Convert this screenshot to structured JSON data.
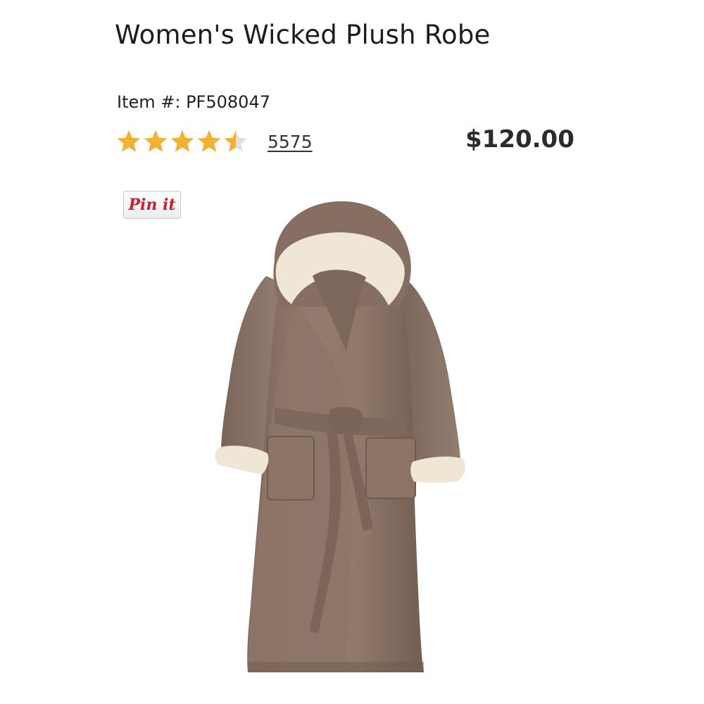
{
  "product": {
    "title": "Women's Wicked Plush Robe",
    "item_number": "Item #: PF508047",
    "rating": 4.5,
    "rating_max": 5,
    "review_count": "5575",
    "price": "$120.00"
  },
  "pin_button": {
    "label": "Pin it"
  },
  "colors": {
    "star": "#F2B134",
    "star_empty": "#E2E2E2",
    "robe": "#8C7467",
    "lining": "#F0E8DA",
    "pin_red": "#C4232D"
  },
  "icons": {
    "star": "star-icon",
    "pinterest": "pinterest-icon"
  }
}
